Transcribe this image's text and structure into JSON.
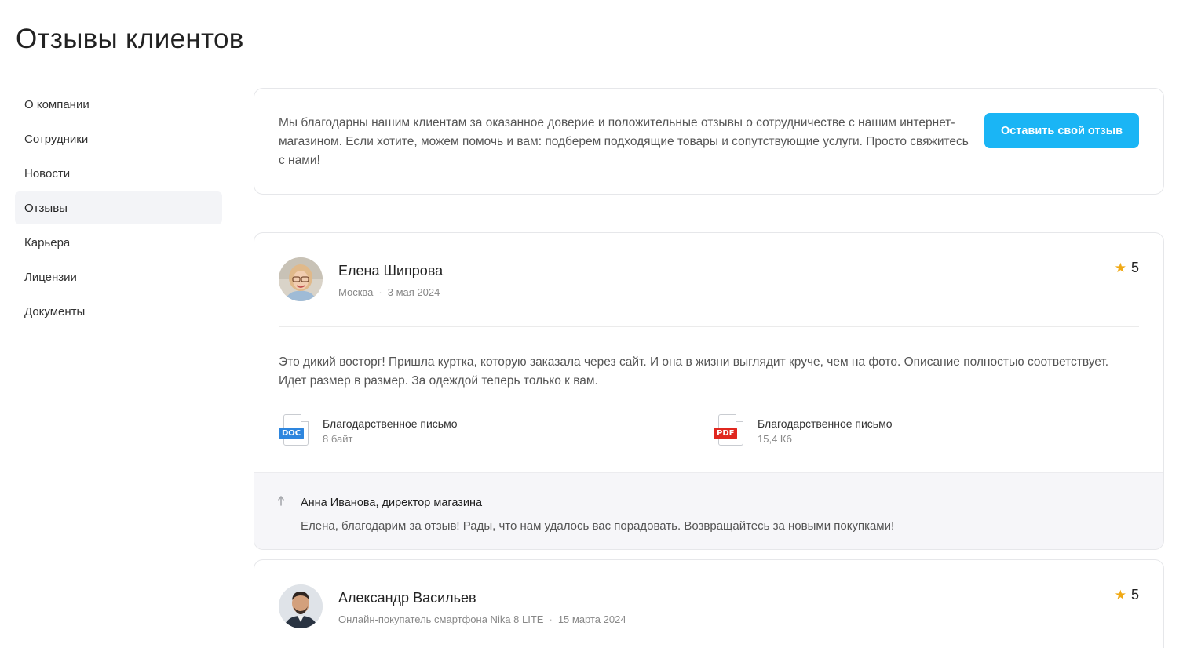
{
  "page": {
    "title": "Отзывы клиентов"
  },
  "sidebar": {
    "items": [
      {
        "label": "О компании",
        "active": false
      },
      {
        "label": "Сотрудники",
        "active": false
      },
      {
        "label": "Новости",
        "active": false
      },
      {
        "label": "Отзывы",
        "active": true
      },
      {
        "label": "Карьера",
        "active": false
      },
      {
        "label": "Лицензии",
        "active": false
      },
      {
        "label": "Документы",
        "active": false
      }
    ]
  },
  "intro": {
    "text": "Мы благодарны нашим клиентам за оказанное доверие и положительные отзывы о сотрудничестве с нашим интернет-магазином. Если хотите, можем помочь и вам: подберем подходящие товары и сопутствующие услуги. Просто свяжитесь с нами!",
    "button_label": "Оставить свой отзыв",
    "button_color": "#1ab5f5"
  },
  "reviews": [
    {
      "author": "Елена Шипрова",
      "location": "Москва",
      "date": "3 мая 2024",
      "rating": "5",
      "text": "Это дикий восторг! Пришла куртка, которую заказала через сайт. И она в жизни выглядит круче, чем на фото. Описание полностью соответствует. Идет размер в размер. За одеждой теперь только к вам.",
      "files": [
        {
          "type": "DOC",
          "name": "Благодарственное письмо",
          "size": "8 байт"
        },
        {
          "type": "PDF",
          "name": "Благодарственное письмо",
          "size": "15,4 Кб"
        }
      ],
      "reply": {
        "author": "Анна Иванова, директор магазина",
        "text": "Елена, благодарим за отзыв! Рады, что нам удалось вас порадовать. Возвращайтесь за новыми покупками!"
      }
    },
    {
      "author": "Александр Васильев",
      "location": "Онлайн-покупатель смартфона Nika 8 LITE",
      "date": "15 марта 2024",
      "rating": "5"
    }
  ],
  "colors": {
    "star": "#f0a915",
    "doc_tag": "#2e86de",
    "pdf_tag": "#e0271f",
    "active_bg": "#f3f4f7"
  }
}
